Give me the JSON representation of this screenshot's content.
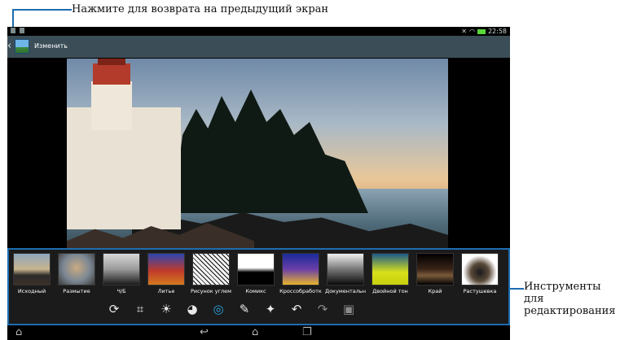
{
  "annotations": {
    "back_hint": "Нажмите для возврата на предыдущий экран",
    "tools_hint": "Инструменты для редактирования"
  },
  "status_bar": {
    "time": "22:58",
    "icons": [
      "notification-icon",
      "gallery-icon",
      "mute-icon",
      "wifi-icon",
      "battery-icon"
    ]
  },
  "action_bar": {
    "title": "Изменить",
    "icon": "gallery-app-icon"
  },
  "filters": [
    {
      "label": "Исходный",
      "style": "original"
    },
    {
      "label": "Размытие",
      "style": "blur"
    },
    {
      "label": "Ч/Б",
      "style": "bw"
    },
    {
      "label": "Литье",
      "style": "cast"
    },
    {
      "label": "Рисунок углем",
      "style": "charcoal"
    },
    {
      "label": "Комикс",
      "style": "comic"
    },
    {
      "label": "Кроссобработк",
      "style": "crossprocess"
    },
    {
      "label": "Документальн",
      "style": "documentary"
    },
    {
      "label": "Двойной тон",
      "style": "duotone"
    },
    {
      "label": "Край",
      "style": "edge"
    },
    {
      "label": "Растушевка",
      "style": "feather"
    }
  ],
  "tools": [
    {
      "name": "rotate-icon",
      "glyph": "⟳"
    },
    {
      "name": "crop-icon",
      "glyph": "⌗"
    },
    {
      "name": "brightness-icon",
      "glyph": "☀"
    },
    {
      "name": "color-palette-icon",
      "glyph": "◕"
    },
    {
      "name": "effects-icon",
      "glyph": "◎"
    },
    {
      "name": "draw-icon",
      "glyph": "✎"
    },
    {
      "name": "sparkle-icon",
      "glyph": "✦"
    },
    {
      "name": "undo-icon",
      "glyph": "↶"
    },
    {
      "name": "redo-icon",
      "glyph": "↷"
    },
    {
      "name": "save-icon",
      "glyph": "▣"
    }
  ],
  "nav_bar": [
    "home-arrow-icon",
    "back-icon",
    "home-icon",
    "recent-apps-icon"
  ],
  "colors": {
    "accent": "#1d6db0",
    "active_tool": "#2aa3e0",
    "action_bar": "#3b4e57"
  }
}
